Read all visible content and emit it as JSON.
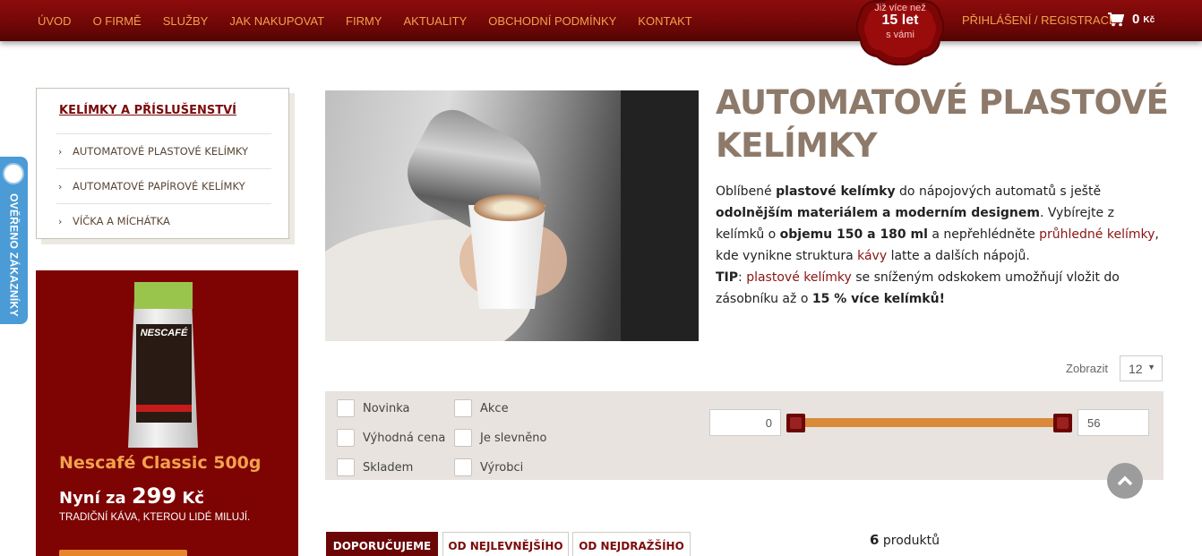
{
  "nav": {
    "items": [
      "ÚVOD",
      "O FIRMĚ",
      "SLUŽBY",
      "JAK NAKUPOVAT",
      "FIRMY",
      "AKTUALITY",
      "OBCHODNÍ PODMÍNKY",
      "KONTAKT"
    ],
    "badge": {
      "line1": "Již více než",
      "line2": "15 let",
      "line3": "s vámi"
    },
    "login": "PŘIHLÁŠENÍ / REGISTRACE",
    "cart_amount": "0",
    "cart_currency": "Kč"
  },
  "sidetab": {
    "label": "OVĚŘENO ZÁKAZNÍKY"
  },
  "categories": {
    "title": "KELÍMKY A PŘÍSLUŠENSTVÍ",
    "items": [
      "AUTOMATOVÉ PLASTOVÉ KELÍMKY",
      "AUTOMATOVÉ PAPÍROVÉ KELÍMKY",
      "VÍČKA A MÍCHÁTKA"
    ]
  },
  "promo": {
    "pack_brand": "NESCAFÉ",
    "name": "Nescafé Classic 500g",
    "price_prefix": "Nyní za",
    "price": "299",
    "currency": "Kč",
    "subtitle": "TRADIČNÍ KÁVA, KTEROU LIDÉ MILUJÍ."
  },
  "headline": "AUTOMATOVÉ PLASTOVÉ KELÍMKY",
  "description": {
    "p1": [
      "Oblíbené ",
      "plastové kelímky",
      " do nápojových automatů s ještě ",
      "odolnějším materiálem a moderním designem",
      ". Vybírejte z kelímků o ",
      "objemu 150 a 180 ml",
      " a nepřehlédněte ",
      "průhledné kelímky",
      ", kde vynikne struktura ",
      "kávy",
      " latte a dalších nápojů."
    ],
    "tip_label": "TIP",
    "tip": [
      ": ",
      "plastové kelímky",
      " se sníženým odskokem umožňují vložit do zásobníku až o ",
      "15 % více kelímků!"
    ]
  },
  "show": {
    "label": "Zobrazit",
    "value": "12"
  },
  "filters": {
    "checkboxes": [
      "Novinka",
      "Akce",
      "Výhodná cena",
      "Je slevněno",
      "Skladem",
      "Výrobci"
    ],
    "price_min": "0",
    "price_max": "56"
  },
  "sort": {
    "tabs": [
      "DOPORUČUJEME",
      "OD NEJLEVNĚJŠÍHO",
      "OD NEJDRAŽŠÍHO"
    ],
    "active": 0
  },
  "count": {
    "number": "6",
    "label": "produktů"
  },
  "colors": {
    "brand_dark": "#6a0606",
    "accent_orange": "#f0a24c",
    "headline": "#8e7a6a"
  }
}
